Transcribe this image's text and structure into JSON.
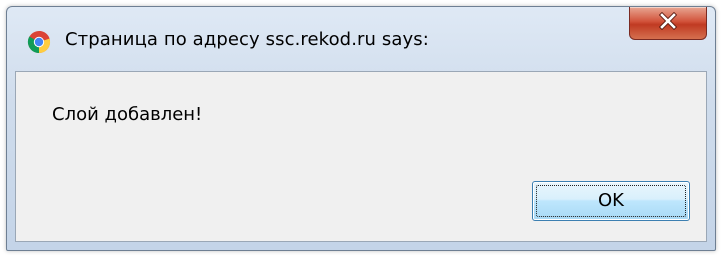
{
  "dialog": {
    "title": "Страница по адресу ssc.rekod.ru says:",
    "message": "Слой добавлен!",
    "ok_label": "OK",
    "app_icon": "chrome-icon",
    "close_icon": "close-icon"
  },
  "colors": {
    "close_button": "#c9462d",
    "ok_button_border": "#3c7fb1",
    "content_background": "#f0f0f0"
  }
}
